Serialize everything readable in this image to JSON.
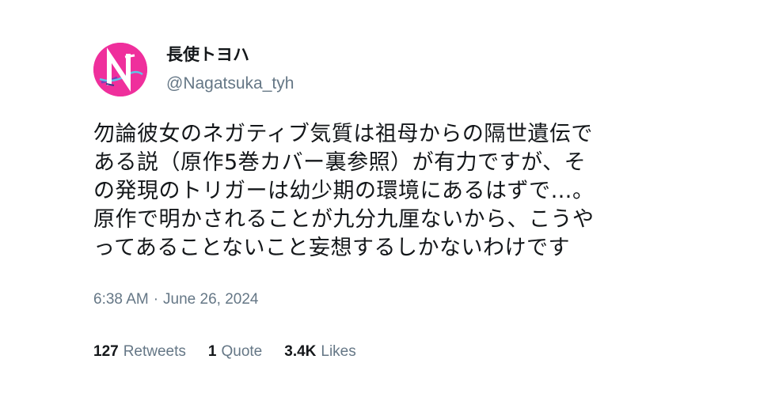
{
  "tweet": {
    "author": {
      "display_name": "長使トヨハ",
      "handle": "@Nagatsuka_tyh",
      "avatar_letter": "N",
      "avatar_color": "#ef2f9c"
    },
    "text": "勿論彼女のネガティブ気質は祖母からの隔世遺伝で\nある説（原作5巻カバー裏参照）が有力ですが、そ\nの発現のトリガーは幼少期の環境にあるはずで…。\n原作で明かされることが九分九厘ないから、こうや\nってあることないこと妄想するしかないわけです",
    "time": "6:38 AM",
    "separator": "·",
    "date": "June 26, 2024",
    "stats": {
      "retweets_count": "127",
      "retweets_label": "Retweets",
      "quotes_count": "1",
      "quotes_label": "Quote",
      "likes_count": "3.4K",
      "likes_label": "Likes"
    }
  },
  "colors": {
    "primary_text": "#14171a",
    "secondary_text": "#657786",
    "avatar_bg": "#ef2f9c"
  }
}
